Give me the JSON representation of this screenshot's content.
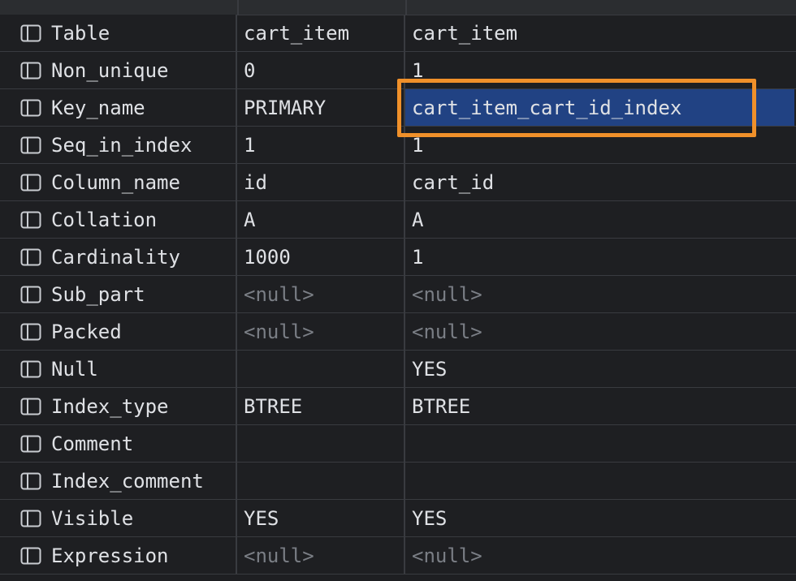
{
  "rows": [
    {
      "name": "Table",
      "v1": "cart_item",
      "v2": "cart_item"
    },
    {
      "name": "Non_unique",
      "v1": "0",
      "v2": "1"
    },
    {
      "name": "Key_name",
      "v1": "PRIMARY",
      "v2": "cart_item_cart_id_index"
    },
    {
      "name": "Seq_in_index",
      "v1": "1",
      "v2": "1"
    },
    {
      "name": "Column_name",
      "v1": "id",
      "v2": "cart_id"
    },
    {
      "name": "Collation",
      "v1": "A",
      "v2": "A"
    },
    {
      "name": "Cardinality",
      "v1": "1000",
      "v2": "1"
    },
    {
      "name": "Sub_part",
      "v1": "<null>",
      "v2": "<null>"
    },
    {
      "name": "Packed",
      "v1": "<null>",
      "v2": "<null>"
    },
    {
      "name": "Null",
      "v1": "",
      "v2": "YES"
    },
    {
      "name": "Index_type",
      "v1": "BTREE",
      "v2": "BTREE"
    },
    {
      "name": "Comment",
      "v1": "",
      "v2": ""
    },
    {
      "name": "Index_comment",
      "v1": "",
      "v2": ""
    },
    {
      "name": "Visible",
      "v1": "YES",
      "v2": "YES"
    },
    {
      "name": "Expression",
      "v1": "<null>",
      "v2": "<null>"
    }
  ],
  "null_text": "<null>",
  "selected_cell": {
    "row": 2,
    "column": "v2"
  },
  "colors": {
    "background": "#1e1f22",
    "selection": "#214283",
    "highlight_border": "#f0902a",
    "null_text": "#7a7e85",
    "text": "#dfe1e5"
  },
  "icons": {
    "row_icon": "column-layout-icon"
  }
}
